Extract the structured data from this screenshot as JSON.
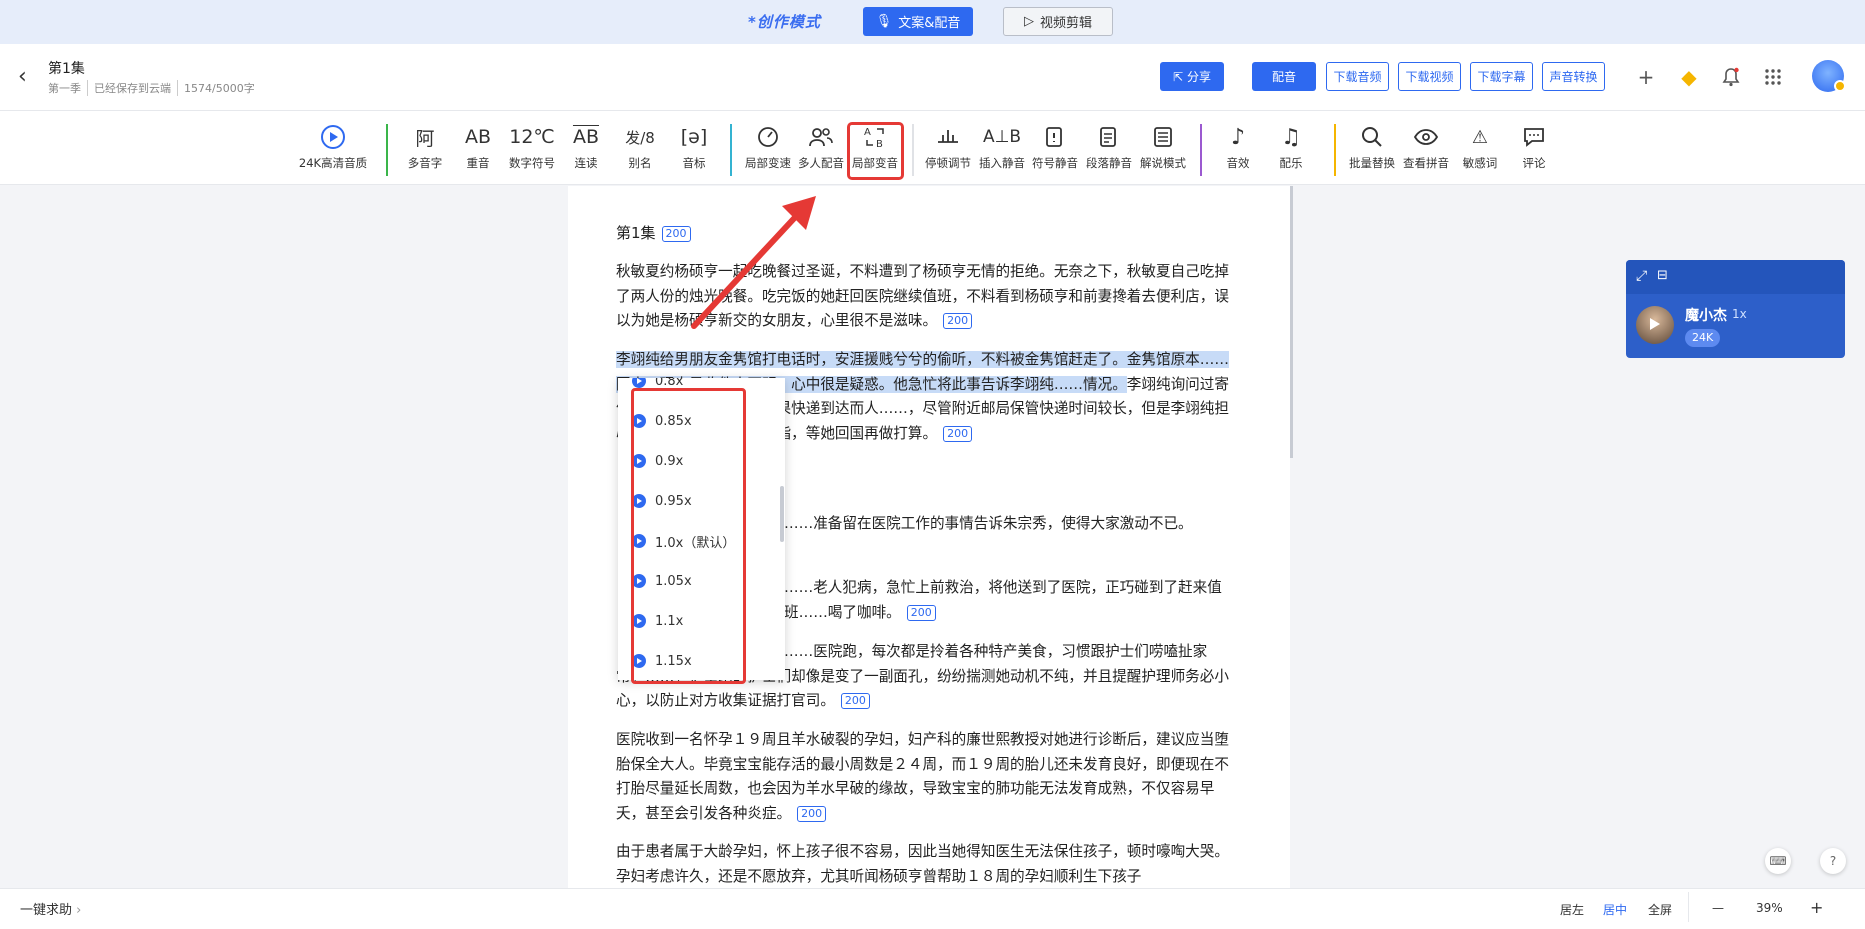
{
  "mode_bar": {
    "label": "*创作模式",
    "active_tab": "文案&配音",
    "inactive_tab": "视频剪辑"
  },
  "header": {
    "title": "第1集",
    "season": "第一季",
    "save_status": "已经保存到云端",
    "char_count": "1574/5000字",
    "buttons": [
      "分享",
      "配音",
      "下载音频",
      "下载视频",
      "下载字幕",
      "声音转换"
    ]
  },
  "toolbar": [
    {
      "label": "24K高清音质",
      "icon": "play-circle-icon"
    },
    {
      "label": "多音字",
      "icon": "polyphone-icon",
      "glyph": "阿"
    },
    {
      "label": "重音",
      "icon": "stress-icon",
      "glyph": "AB"
    },
    {
      "label": "数字符号",
      "icon": "number-icon",
      "glyph": "12℃"
    },
    {
      "label": "连读",
      "icon": "liaison-icon",
      "glyph": "AB"
    },
    {
      "label": "别名",
      "icon": "alias-icon",
      "glyph": "发/8"
    },
    {
      "label": "音标",
      "icon": "phonetic-icon",
      "glyph": "[ə]"
    },
    {
      "label": "局部变速",
      "icon": "speedometer-icon"
    },
    {
      "label": "多人配音",
      "icon": "people-icon"
    },
    {
      "label": "局部变音",
      "icon": "voice-change-icon"
    },
    {
      "label": "停顿调节",
      "icon": "pause-adjust-icon"
    },
    {
      "label": "插入静音",
      "icon": "insert-silence-icon"
    },
    {
      "label": "符号静音",
      "icon": "symbol-silence-icon"
    },
    {
      "label": "段落静音",
      "icon": "paragraph-silence-icon"
    },
    {
      "label": "解说模式",
      "icon": "narration-icon"
    },
    {
      "label": "音效",
      "icon": "sound-effect-icon"
    },
    {
      "label": "配乐",
      "icon": "music-icon"
    },
    {
      "label": "批量替换",
      "icon": "search-icon"
    },
    {
      "label": "查看拼音",
      "icon": "eye-icon"
    },
    {
      "label": "敏感词",
      "icon": "sensitive-icon"
    },
    {
      "label": "评论",
      "icon": "comment-icon"
    }
  ],
  "document": {
    "episode_title": "第1集",
    "episode_tag": "200",
    "paragraphs": [
      {
        "text": "秋敏夏约杨硕亨一起吃晚餐过圣诞，不料遭到了杨硕亨无情的拒绝。无奈之下，秋敏夏自己吃掉了两人份的烛光晚餐。吃完饭的她赶回医院继续值班，不料看到杨硕亨和前妻搀着去便利店，误以为她是杨硕亨新交的女朋友，心里很不是滋味。",
        "tag": "200"
      },
      {
        "text_selected": "李翊纯给男朋友金隽馆打电话时，安涯援贱兮兮的偷听，不料被金隽馆赶走了。金隽馆原本……回来，理由是收件人不明，心中很是疑惑。他急忙将此事告诉李翊纯……情况。",
        "text_rest": "李翊纯询问过寄件员才知住处有规定，如果快递到达而人……，尽管附近邮局保管快递时间较长，但是李翊纯担心会出现其他问……着戒指，等她回国再做打算。",
        "tag": "200"
      },
      {
        "text": "……准备留在医院工作的事情告诉朱宗秀，使得大家激动不已。"
      },
      {
        "text": "……老人犯病，急忙上前救治，将他送到了医院，正巧碰到了赶来值班……喝了咖啡。",
        "tag": "200"
      },
      {
        "text": "……医院跑，每次都是拎着各种特产美食，习惯跟护士们唠嗑扯家常。……，护士站的护士们却像是变了一副面孔，纷纷揣测她动机不纯，并且提醒护理师务必小心，以防止对方收集证据打官司。",
        "tag": "200"
      },
      {
        "text": "医院收到一名怀孕１９周且羊水破裂的孕妇，妇产科的廉世熙教授对她进行诊断后，建议应当堕胎保全大人。毕竟宝宝能存活的最小周数是２４周，而１９周的胎儿还未发育良好，即便现在不打胎尽量延长周数，也会因为羊水早破的缘故，导致宝宝的肺功能无法发育成熟，不仅容易早夭，甚至会引发各种炎症。",
        "tag": "200"
      },
      {
        "text": "由于患者属于大龄孕妇，怀上孩子很不容易，因此当她得知医生无法保住孩子，顿时嚎啕大哭。孕妇考虑许久，还是不愿放弃，尤其听闻杨硕亨曾帮助１８周的孕妇顺利生下孩子"
      }
    ]
  },
  "speed_dropdown": {
    "items": [
      "0.8x",
      "0.85x",
      "0.9x",
      "0.95x",
      "1.0x（默认）",
      "1.05x",
      "1.1x",
      "1.15x"
    ]
  },
  "voice_card": {
    "name": "魔小杰",
    "rate": "1x",
    "quality": "24K"
  },
  "footer": {
    "help": "一键求助",
    "align_left": "居左",
    "align_center": "居中",
    "fullscreen": "全屏",
    "zoom_minus": "—",
    "zoom": "39%",
    "zoom_plus": "+"
  },
  "colors": {
    "accent": "#2e69f0",
    "highlight": "#e53935",
    "selection": "#c7dbf7"
  }
}
